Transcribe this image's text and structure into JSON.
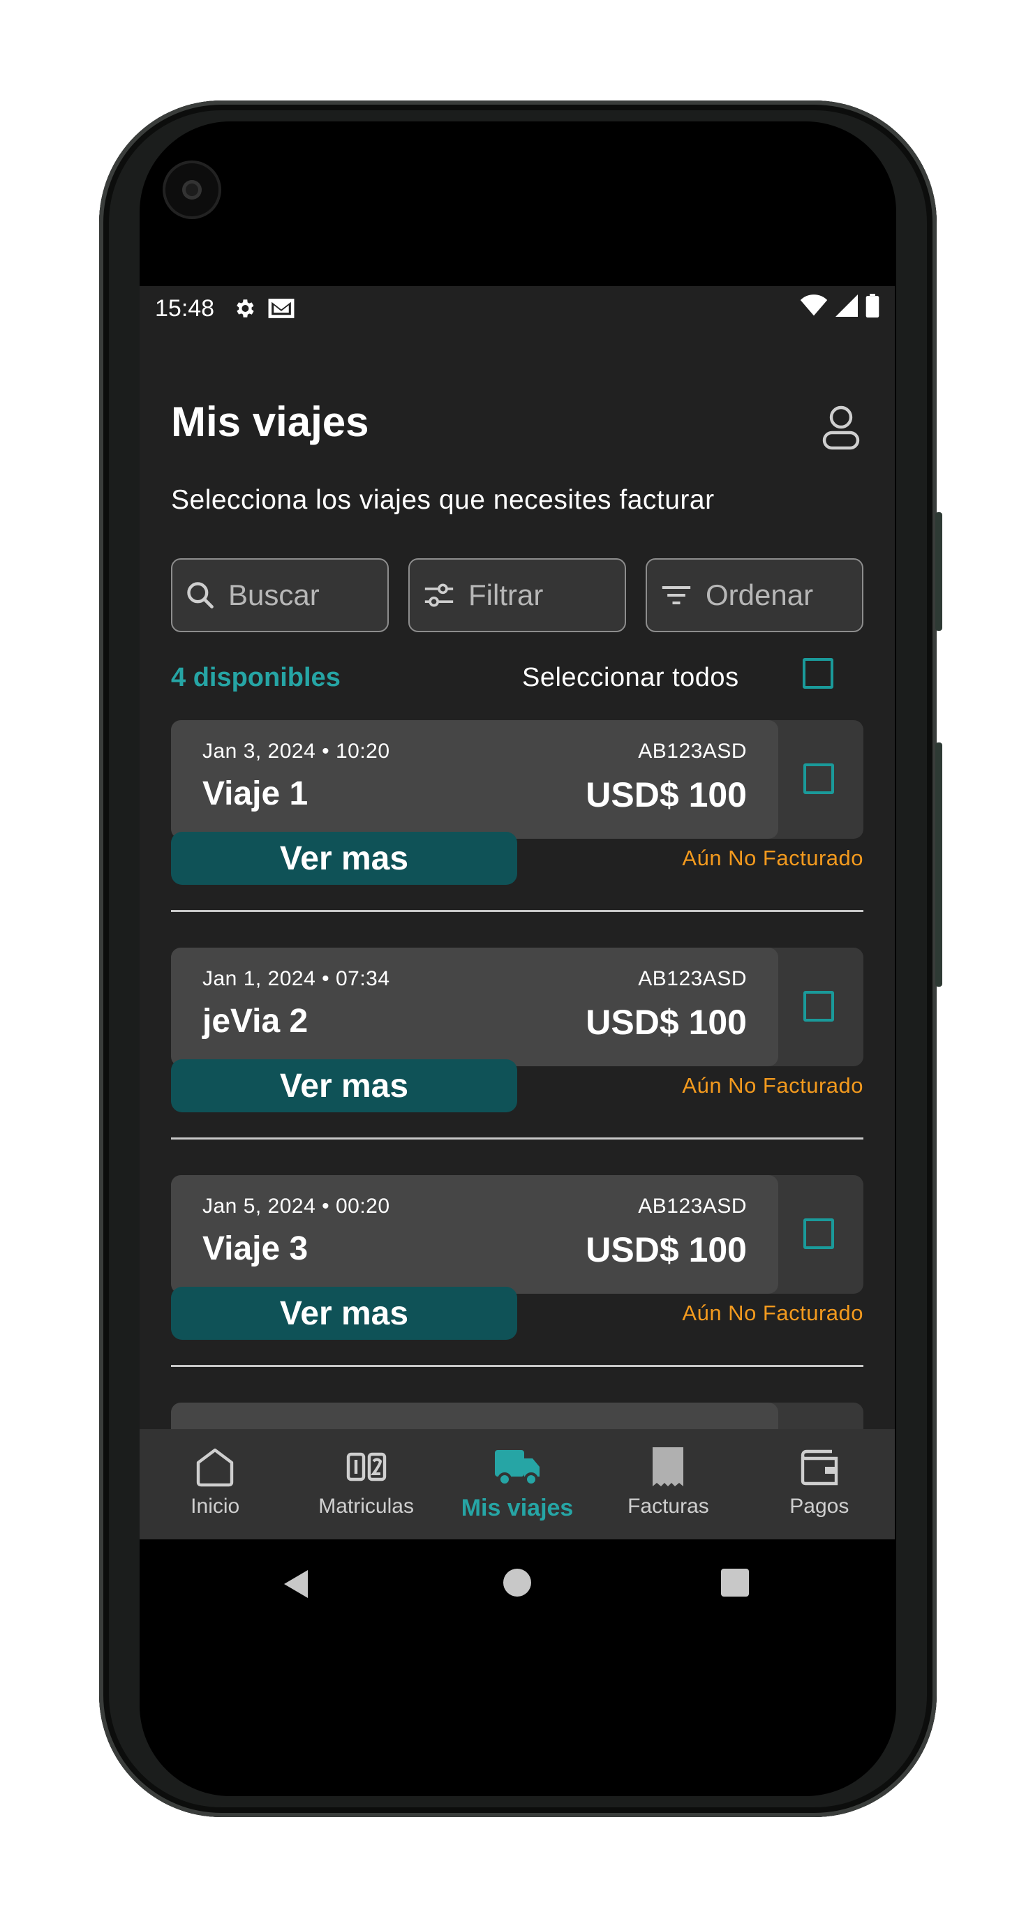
{
  "status_bar": {
    "time": "15:48",
    "left_icons": [
      "settings-icon",
      "mail-icon"
    ],
    "right_icons": [
      "wifi-icon",
      "signal-icon",
      "battery-icon"
    ]
  },
  "header": {
    "title": "Mis viajes",
    "subtitle": "Selecciona los viajes que necesites facturar"
  },
  "toolbar": {
    "search_placeholder": "Buscar",
    "filter_label": "Filtrar",
    "sort_label": "Ordenar"
  },
  "list": {
    "available_count": "4 disponibles",
    "select_all_label": "Seleccionar todos",
    "select_all_checked": false
  },
  "trips": [
    {
      "datetime": "Jan 3, 2024 • 10:20",
      "name": "Viaje 1",
      "plate": "AB123ASD",
      "amount": "USD$ 100",
      "more_label": "Ver mas",
      "status": "Aún No Facturado",
      "checked": false
    },
    {
      "datetime": "Jan 1, 2024 • 07:34",
      "name": "jeVia 2",
      "plate": "AB123ASD",
      "amount": "USD$ 100",
      "more_label": "Ver mas",
      "status": "Aún No Facturado",
      "checked": false
    },
    {
      "datetime": "Jan 5, 2024 • 00:20",
      "name": "Viaje 3",
      "plate": "AB123ASD",
      "amount": "USD$ 100",
      "more_label": "Ver mas",
      "status": "Aún No Facturado",
      "checked": false
    }
  ],
  "bottom_nav": {
    "items": [
      {
        "label": "Inicio",
        "icon": "home-icon",
        "active": false
      },
      {
        "label": "Matriculas",
        "icon": "plates-icon",
        "active": false
      },
      {
        "label": "Mis viajes",
        "icon": "truck-icon",
        "active": true
      },
      {
        "label": "Facturas",
        "icon": "receipt-icon",
        "active": false
      },
      {
        "label": "Pagos",
        "icon": "wallet-icon",
        "active": false
      }
    ]
  },
  "colors": {
    "accent": "#26a5a5",
    "button_dark_teal": "#0f5257",
    "status_orange": "#f39a1e",
    "background": "#212121",
    "card": "#464646"
  }
}
